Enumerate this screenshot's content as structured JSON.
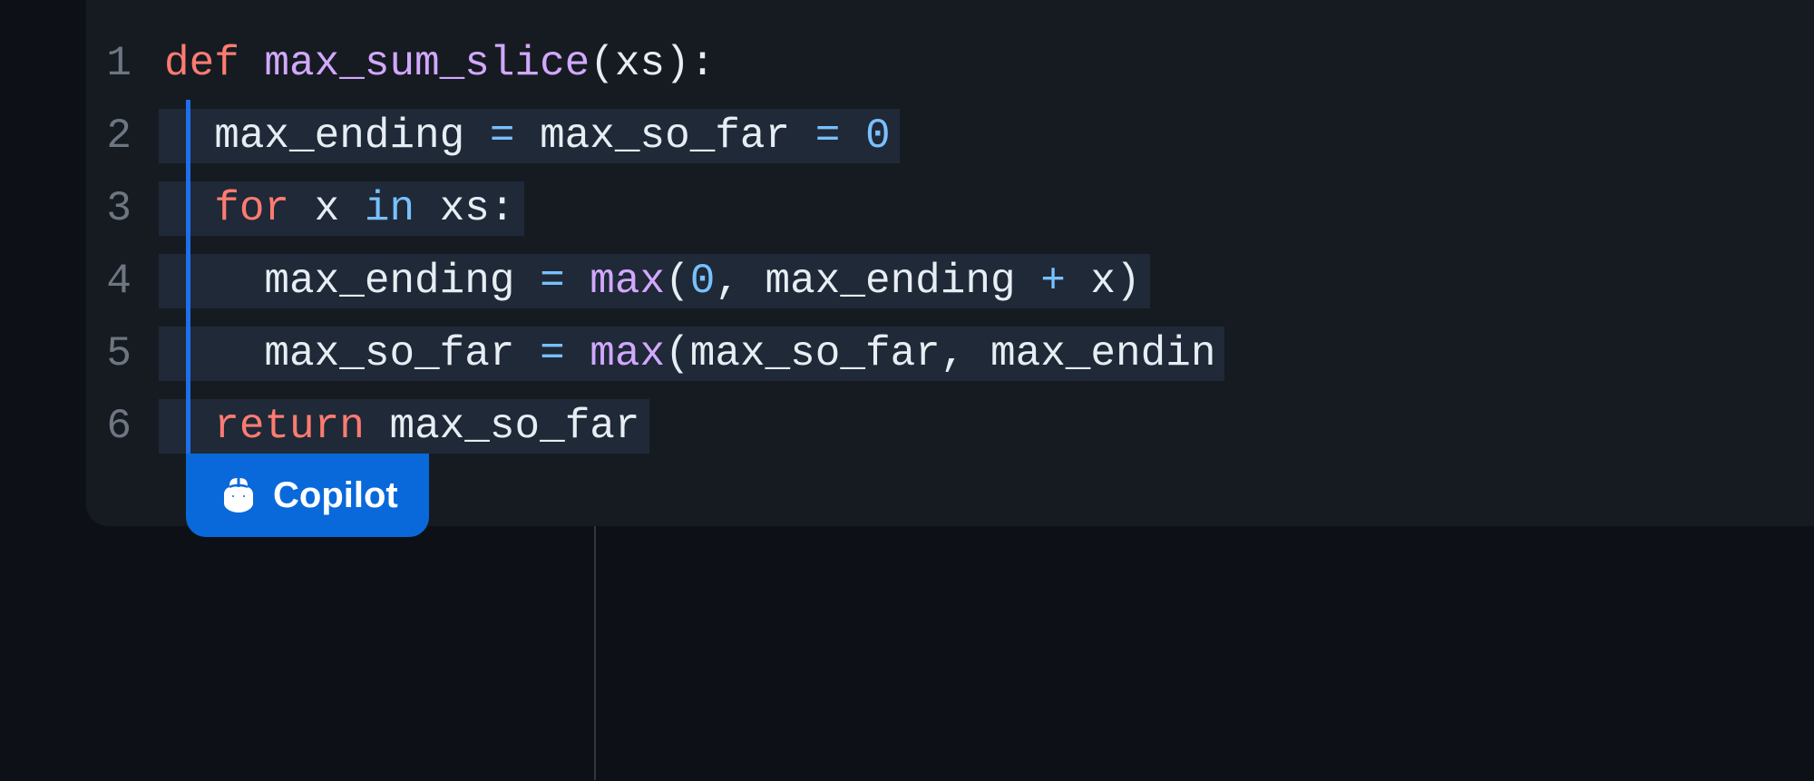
{
  "editor": {
    "lines": [
      {
        "number": "1",
        "tokens": [
          {
            "text": "def ",
            "cls": "kw-def"
          },
          {
            "text": "max_sum_slice",
            "cls": "fn-name"
          },
          {
            "text": "(",
            "cls": "paren"
          },
          {
            "text": "xs",
            "cls": "param"
          },
          {
            "text": ")",
            "cls": "paren"
          },
          {
            "text": ":",
            "cls": "colon"
          }
        ]
      },
      {
        "number": "2",
        "tokens": [
          {
            "text": "  max_ending ",
            "cls": "ident"
          },
          {
            "text": "=",
            "cls": "op"
          },
          {
            "text": " max_so_far ",
            "cls": "ident"
          },
          {
            "text": "=",
            "cls": "op"
          },
          {
            "text": " ",
            "cls": "ident"
          },
          {
            "text": "0",
            "cls": "num"
          }
        ]
      },
      {
        "number": "3",
        "tokens": [
          {
            "text": "  ",
            "cls": "ident"
          },
          {
            "text": "for",
            "cls": "kw-for"
          },
          {
            "text": " x ",
            "cls": "ident"
          },
          {
            "text": "in",
            "cls": "kw-in"
          },
          {
            "text": " xs",
            "cls": "ident"
          },
          {
            "text": ":",
            "cls": "colon"
          }
        ]
      },
      {
        "number": "4",
        "tokens": [
          {
            "text": "    max_ending ",
            "cls": "ident"
          },
          {
            "text": "=",
            "cls": "op"
          },
          {
            "text": " ",
            "cls": "ident"
          },
          {
            "text": "max",
            "cls": "fn-call"
          },
          {
            "text": "(",
            "cls": "paren"
          },
          {
            "text": "0",
            "cls": "num"
          },
          {
            "text": ",",
            "cls": "comma"
          },
          {
            "text": " max_ending ",
            "cls": "ident"
          },
          {
            "text": "+",
            "cls": "op"
          },
          {
            "text": " x",
            "cls": "ident"
          },
          {
            "text": ")",
            "cls": "paren"
          }
        ]
      },
      {
        "number": "5",
        "tokens": [
          {
            "text": "    max_so_far ",
            "cls": "ident"
          },
          {
            "text": "=",
            "cls": "op"
          },
          {
            "text": " ",
            "cls": "ident"
          },
          {
            "text": "max",
            "cls": "fn-call"
          },
          {
            "text": "(",
            "cls": "paren"
          },
          {
            "text": "max_so_far",
            "cls": "ident"
          },
          {
            "text": ",",
            "cls": "comma"
          },
          {
            "text": " max_endin",
            "cls": "ident"
          }
        ]
      },
      {
        "number": "6",
        "tokens": [
          {
            "text": "  ",
            "cls": "ident"
          },
          {
            "text": "return",
            "cls": "kw-return"
          },
          {
            "text": " max_so_far",
            "cls": "ident"
          }
        ]
      }
    ]
  },
  "copilot": {
    "label": "Copilot"
  }
}
